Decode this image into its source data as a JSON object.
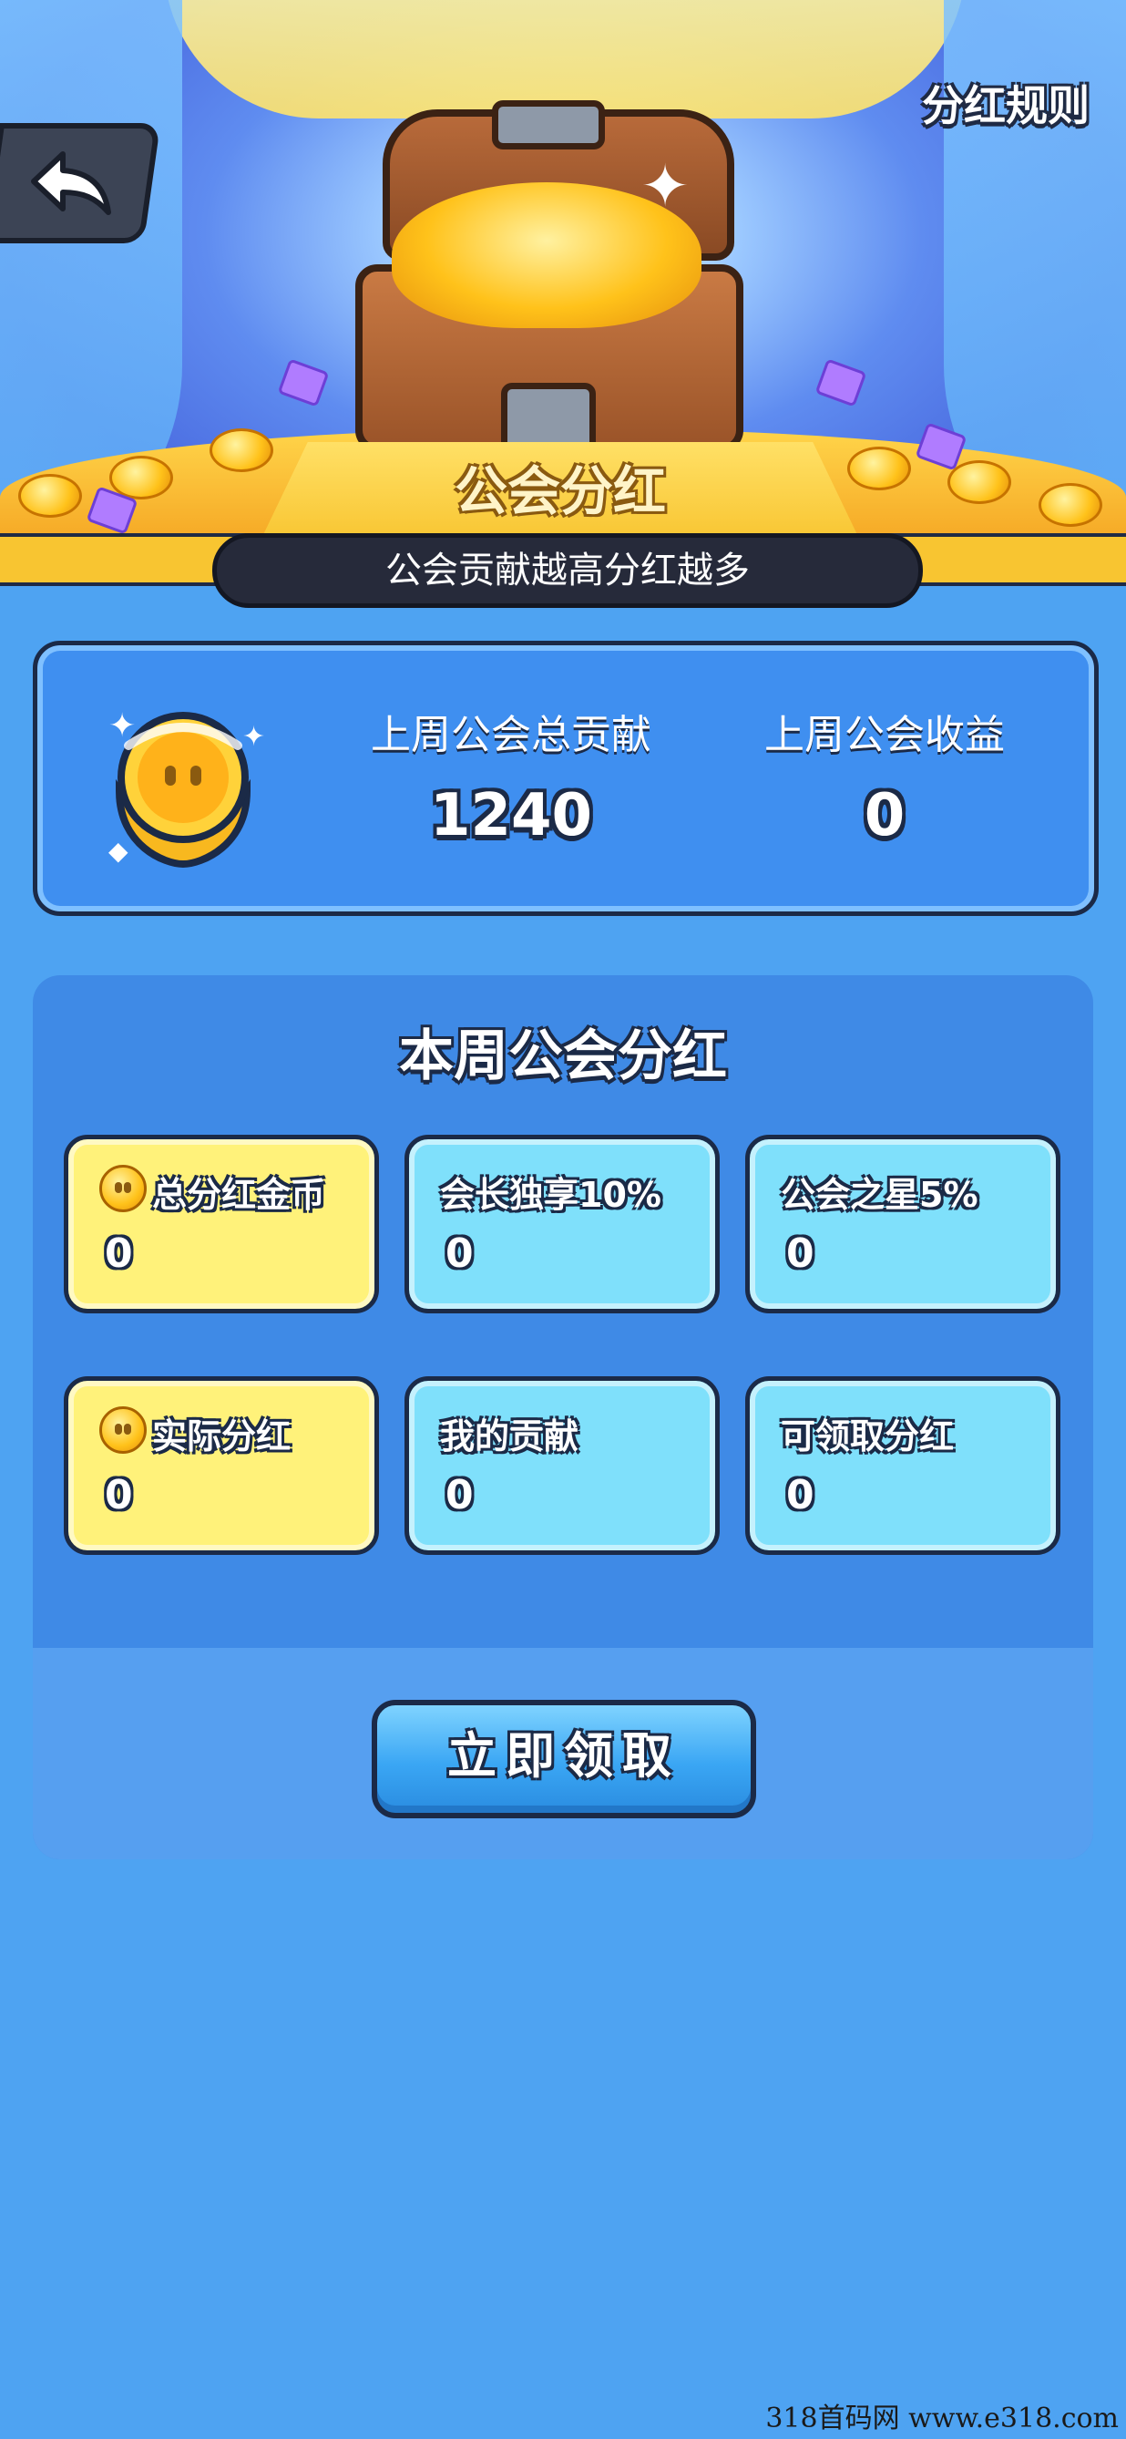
{
  "header": {
    "rules_label": "分红规则",
    "banner_title": "公会分红",
    "banner_subtitle": "公会贡献越高分红越多"
  },
  "stats": {
    "last_week_contribution_label": "上周公会总贡献",
    "last_week_contribution_value": "1240",
    "last_week_income_label": "上周公会收益",
    "last_week_income_value": "0"
  },
  "weekly": {
    "title": "本周公会分红",
    "tiles": [
      {
        "label": "总分红金币",
        "value": "0",
        "style": "yellow",
        "coin_icon": true
      },
      {
        "label": "会长独享10%",
        "value": "0",
        "style": "cyan",
        "coin_icon": false
      },
      {
        "label": "公会之星5%",
        "value": "0",
        "style": "cyan",
        "coin_icon": false
      },
      {
        "label": "实际分红",
        "value": "0",
        "style": "yellow",
        "coin_icon": true
      },
      {
        "label": "我的贡献",
        "value": "0",
        "style": "cyan",
        "coin_icon": false
      },
      {
        "label": "可领取分红",
        "value": "0",
        "style": "cyan",
        "coin_icon": false
      }
    ],
    "claim_button": "立即领取"
  },
  "watermark": "318首码网 www.e318.com",
  "colors": {
    "background": "#4ea3f2",
    "tile_yellow": "#fff27a",
    "tile_cyan": "#7fe0fb",
    "banner_gold": "#f8c531",
    "outline": "#1b2a47"
  },
  "icons": {
    "back": "back-arrow-icon",
    "medal": "laurel-medal-icon",
    "coin": "coin-icon",
    "chest": "treasure-chest-icon"
  }
}
